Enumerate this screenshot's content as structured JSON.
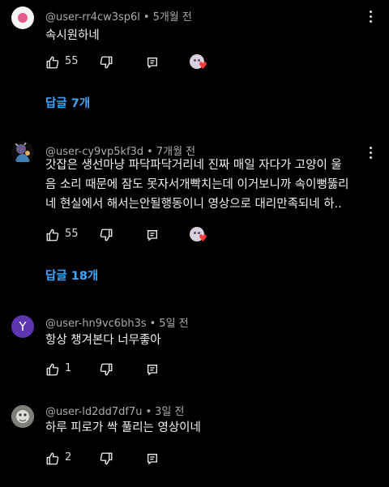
{
  "comments": [
    {
      "username": "@user-rr4cw3sp6l",
      "time": "5개월 전",
      "text": [
        "속시원하네"
      ],
      "likes": "55",
      "replies_label": "답글 7개",
      "avatar_icon": "pink-circle-avatar",
      "creator_heart": true
    },
    {
      "username": "@user-cy9vp5kf3d",
      "time": "7개월 전",
      "text": [
        "갓잡은 생선마냥 파닥파닥거리네 진짜 매일 자다가 고양이 울",
        "음 소리 때문에 잠도 못자서개빡치는데 이거보니까 속이뻥뚫리",
        "네 현실에서 해서는안될행동이니 영상으로 대리만족되네 하.."
      ],
      "likes": "55",
      "replies_label": "답글 18개",
      "avatar_icon": "character-avatar",
      "creator_heart": true
    },
    {
      "username": "@user-hn9vc6bh3s",
      "time": "5일 전",
      "text": [
        "항상 챙겨본다 너무좋아"
      ],
      "likes": "1",
      "avatar_letter": "Y",
      "avatar_color": "#5e35b1"
    },
    {
      "username": "@user-ld2dd7df7u",
      "time": "3일 전",
      "text": [
        "하루 피로가 싹 풀리는 영상이네"
      ],
      "likes": "2",
      "avatar_icon": "photo-avatar"
    }
  ],
  "separator": "•",
  "colors": {
    "background": "#000000",
    "link": "#3ea6ff",
    "meta": "#aaaaaa",
    "heart": "#ff3b3b",
    "pink_avatar": "#e35a8c"
  }
}
